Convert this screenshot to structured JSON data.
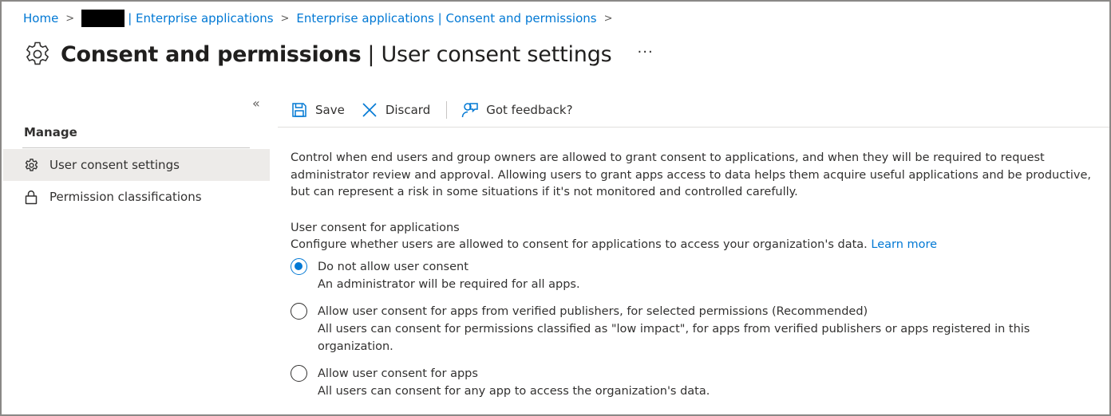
{
  "breadcrumb": {
    "home": "Home",
    "tenant_suffix": "| Enterprise applications",
    "enterprise_apps": "Enterprise applications | Consent and permissions"
  },
  "header": {
    "title_main": "Consent and permissions",
    "title_separator": "|",
    "title_sub": "User consent settings",
    "more_label": "···",
    "icon": "gear-icon"
  },
  "sidebar": {
    "collapse_label": "«",
    "section_label": "Manage",
    "items": [
      {
        "label": "User consent settings",
        "icon": "gear-icon",
        "active": true
      },
      {
        "label": "Permission classifications",
        "icon": "lock-icon",
        "active": false
      }
    ]
  },
  "toolbar": {
    "save_label": "Save",
    "discard_label": "Discard",
    "feedback_label": "Got feedback?"
  },
  "content": {
    "intro": "Control when end users and group owners are allowed to grant consent to applications, and when they will be required to request administrator review and approval. Allowing users to grant apps access to data helps them acquire useful applications and be productive, but can represent a risk in some situations if it's not monitored and controlled carefully.",
    "section_title": "User consent for applications",
    "section_desc": "Configure whether users are allowed to consent for applications to access your organization's data.",
    "learn_more": "Learn more",
    "options": [
      {
        "label": "Do not allow user consent",
        "description": "An administrator will be required for all apps.",
        "selected": true
      },
      {
        "label": "Allow user consent for apps from verified publishers, for selected permissions (Recommended)",
        "description": "All users can consent for permissions classified as \"low impact\", for apps from verified publishers or apps registered in this organization.",
        "selected": false
      },
      {
        "label": "Allow user consent for apps",
        "description": "All users can consent for any app to access the organization's data.",
        "selected": false
      }
    ]
  },
  "colors": {
    "accent": "#0078d4",
    "text": "#323130",
    "active_nav_bg": "#edebe9"
  }
}
